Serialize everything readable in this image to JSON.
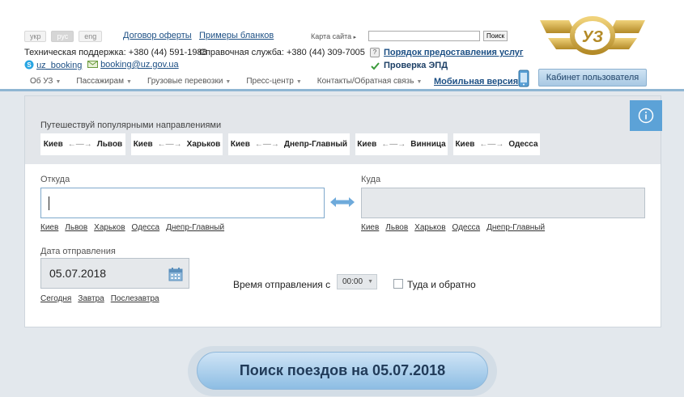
{
  "header": {
    "languages": [
      {
        "label": "укр",
        "active": false
      },
      {
        "label": "рус",
        "active": true
      },
      {
        "label": "eng",
        "active": false
      }
    ],
    "offer_link": "Договор оферты",
    "samples_link": "Примеры бланков",
    "sitemap": "Карта сайта",
    "search_button": "Поиск",
    "tech_support_label": "Техническая поддержка:",
    "tech_support_phone": "+380 (44) 591-1988",
    "help_label": "Справочная служба:",
    "help_phone": "+380 (44) 309-7005",
    "skype": "uz_booking",
    "email": "booking@uz.gov.ua",
    "services_link": "Порядок предоставления услуг",
    "epd_link": "Проверка ЭПД",
    "mobile_link": "Мобильная версия",
    "cabinet_button": "Кабинет пользователя",
    "logo_text": "УЗ",
    "menu": [
      "Об УЗ",
      "Пассажирам",
      "Грузовые перевозки",
      "Пресс-центр",
      "Контакты/Обратная связь"
    ]
  },
  "popular": {
    "title": "Путешествуй популярными направлениями",
    "routes": [
      {
        "from": "Киев",
        "to": "Львов"
      },
      {
        "from": "Киев",
        "to": "Харьков"
      },
      {
        "from": "Киев",
        "to": "Днепр-Главный"
      },
      {
        "from": "Киев",
        "to": "Винница"
      },
      {
        "from": "Киев",
        "to": "Одесса"
      }
    ]
  },
  "form": {
    "from_label": "Откуда",
    "to_label": "Куда",
    "from_value": "",
    "to_value": "",
    "quick_cities": [
      "Киев",
      "Львов",
      "Харьков",
      "Одесса",
      "Днепр-Главный"
    ],
    "date_label": "Дата отправления",
    "date_value": "05.07.2018",
    "date_shortcuts": [
      "Сегодня",
      "Завтра",
      "Послезавтра"
    ],
    "time_label": "Время отправления с",
    "time_value": "00:00",
    "roundtrip_label": "Туда и обратно",
    "roundtrip_checked": false
  },
  "search": {
    "button": "Поиск поездов на 05.07.2018"
  },
  "colors": {
    "accent": "#5ca2d7",
    "link": "#1c4f84",
    "logo_gold": "#c9a43a"
  }
}
